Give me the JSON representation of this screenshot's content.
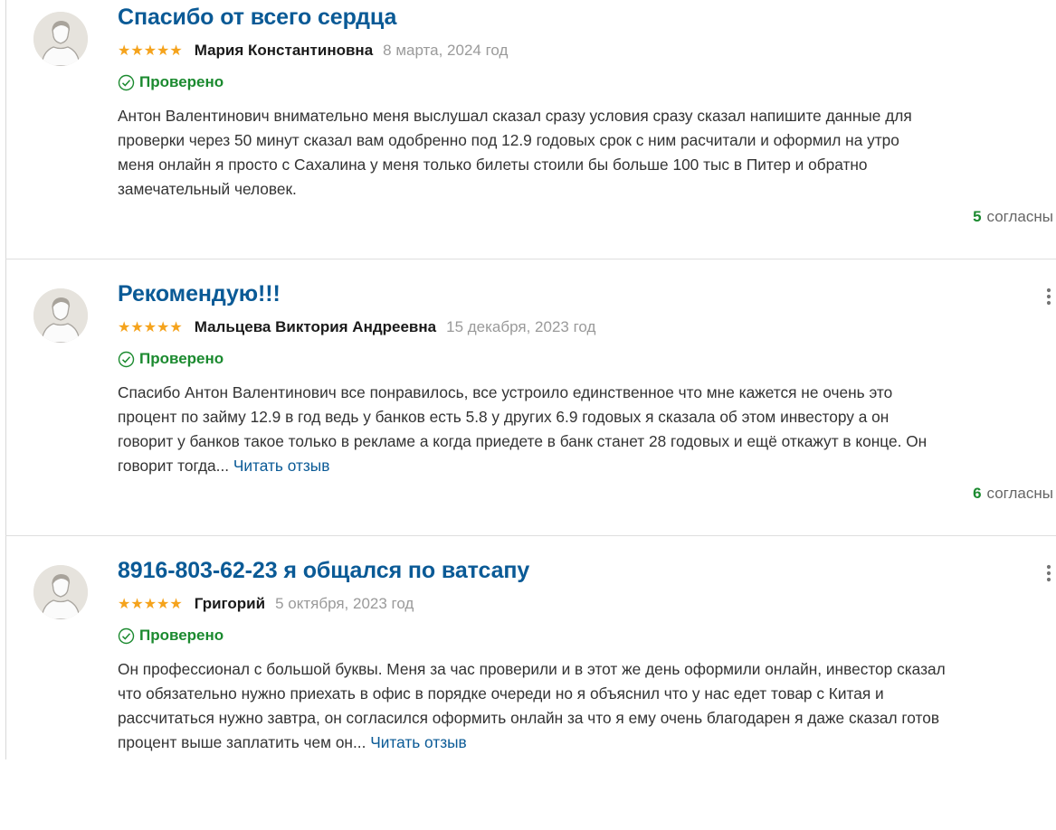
{
  "reviews": [
    {
      "title": "Спасибо от всего сердца",
      "rating": "★★★★★",
      "author": "Мария Константиновна",
      "date": "8 марта, 2024 год",
      "verified": "Проверено",
      "text_lines": [
        "Антон Валентинович внимательно меня выслушал сказал сразу условия сразу сказал напишите данные для",
        "проверки через 50 минут сказал вам одобренно под 12.9 годовых срок с ним расчитали и оформил на утро",
        "меня онлайн я просто с Сахалина у меня только билеты стоили бы больше 100 тыс в Питер и обратно",
        "замечательный человек."
      ],
      "agree_count": "5",
      "agree_label": "согласны"
    },
    {
      "title": "Рекомендую!!!",
      "rating": "★★★★★",
      "author": "Мальцева Виктория Андреевна",
      "date": "15 декабря, 2023 год",
      "verified": "Проверено",
      "text_lines": [
        "Спасибо Антон Валентинович все понравилось, все устроило единственное что мне кажется не очень это",
        "процент по займу 12.9 в год ведь у банков есть 5.8 у других 6.9 годовых я сказала об этом инвестору а он",
        "говорит у банков такое только в рекламе а когда приедете в банк станет 28 годовых и ещё откажут в конце. Он",
        "говорит тогда..."
      ],
      "read_more": "Читать отзыв",
      "agree_count": "6",
      "agree_label": "согласны"
    },
    {
      "title": "8916-803-62-23 я общался по ватсапу",
      "rating": "★★★★★",
      "author": "Григорий",
      "date": "5 октября, 2023 год",
      "verified": "Проверено",
      "text_lines": [
        "Он профессионал с большой буквы. Меня за час проверили и в этот же день оформили онлайн, инвестор сказал",
        "что обязательно нужно приехать в офис в порядке очереди но я объяснил что у нас едет товар с Китая и",
        "рассчитаться нужно завтра, он согласился оформить онлайн за что я ему очень благодарен я даже сказал готов",
        "процент выше заплатить чем он..."
      ],
      "read_more": "Читать отзыв"
    }
  ],
  "colors": {
    "title": "#0a5a96",
    "stars": "#f5a31c",
    "verified": "#1b8a2f",
    "date": "#9a9a9a",
    "divider": "#dedede"
  },
  "icons": {
    "avatar": "user-placeholder-icon",
    "verified": "check-circle-icon",
    "menu": "more-vertical-icon"
  }
}
